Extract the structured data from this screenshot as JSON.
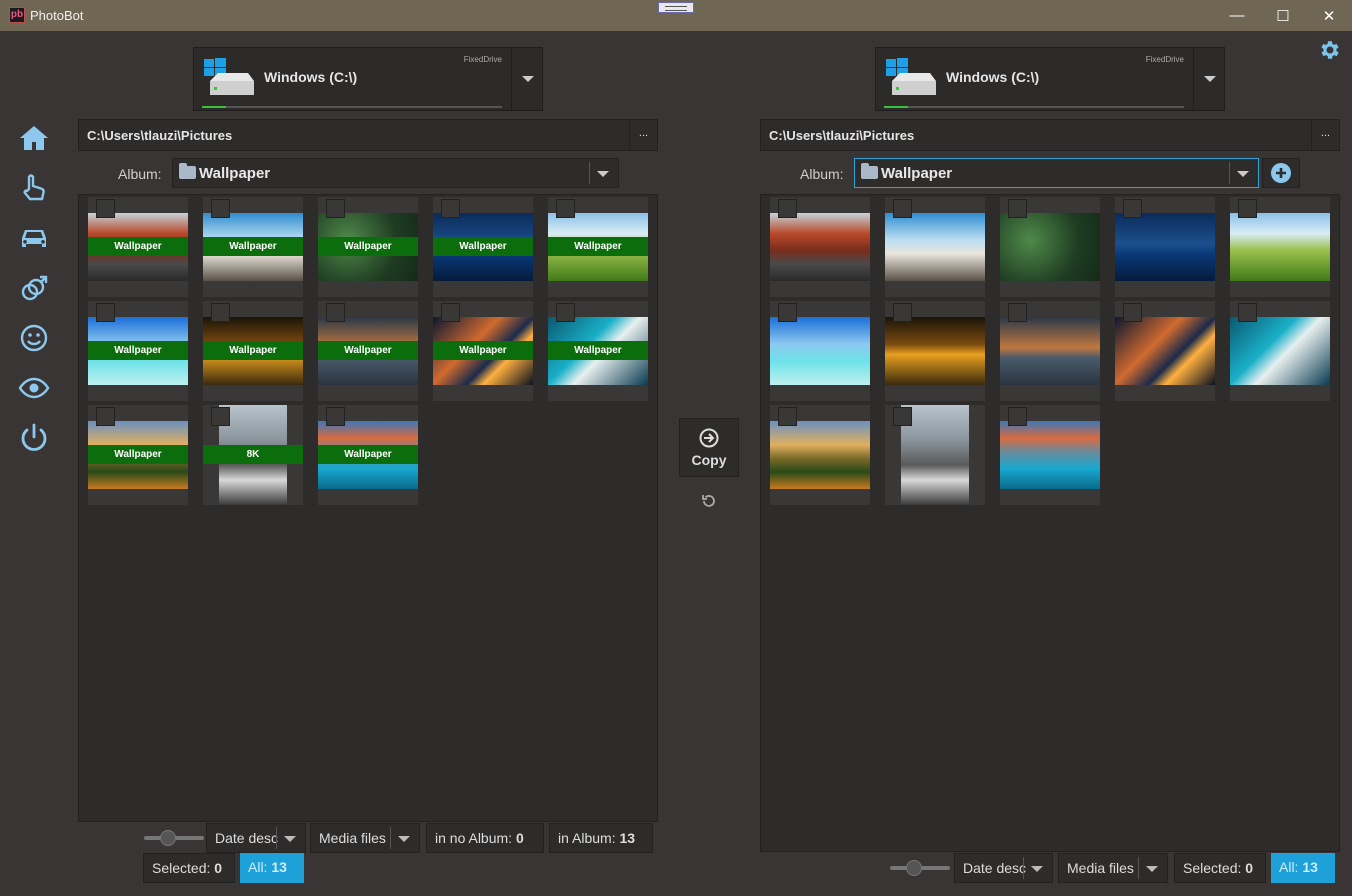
{
  "app": {
    "title": "PhotoBot",
    "logo_text": "pb"
  },
  "window_controls": {
    "minimize": "—",
    "maximize": "☐",
    "close": "✕"
  },
  "sidebar": {
    "items": [
      "home-icon",
      "pointer-hand-icon",
      "car-icon",
      "gender-icon",
      "smiley-icon",
      "eye-icon",
      "power-icon"
    ]
  },
  "left": {
    "drive": {
      "name": "Windows (C:\\)",
      "type": "FixedDrive"
    },
    "path": "C:\\Users\\tlauzi\\Pictures",
    "path_button": "...",
    "album_label": "Album:",
    "album": "Wallpaper",
    "thumbnails": [
      {
        "label": "Wallpaper"
      },
      {
        "label": "Wallpaper"
      },
      {
        "label": "Wallpaper"
      },
      {
        "label": "Wallpaper"
      },
      {
        "label": "Wallpaper"
      },
      {
        "label": "Wallpaper"
      },
      {
        "label": "Wallpaper"
      },
      {
        "label": "Wallpaper"
      },
      {
        "label": "Wallpaper"
      },
      {
        "label": "Wallpaper"
      },
      {
        "label": "Wallpaper"
      },
      {
        "label": "8K"
      },
      {
        "label": "Wallpaper"
      }
    ],
    "sort": "Date desc",
    "filter": "Media files",
    "no_album_label": "in no Album:",
    "no_album_count": "0",
    "in_album_label": "in Album:",
    "in_album_count": "13",
    "selected_label": "Selected:",
    "selected_count": "0",
    "all_label": "All:",
    "all_count": "13"
  },
  "middle": {
    "copy_label": "Copy"
  },
  "right": {
    "drive": {
      "name": "Windows (C:\\)",
      "type": "FixedDrive"
    },
    "path": "C:\\Users\\tlauzi\\Pictures",
    "path_button": "...",
    "album_label": "Album:",
    "album": "Wallpaper",
    "sort": "Date desc",
    "filter": "Media files",
    "selected_label": "Selected:",
    "selected_count": "0",
    "all_label": "All:",
    "all_count": "13"
  },
  "colors": {
    "accent": "#1ea0d8",
    "tag_green": "#0c6d0c",
    "titlebar": "#6f6754",
    "background": "#383534"
  }
}
